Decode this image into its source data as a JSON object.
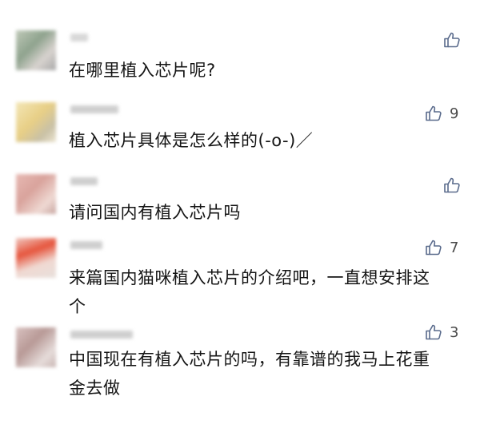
{
  "comments": [
    {
      "text": "在哪里植入芯片呢?",
      "likes": ""
    },
    {
      "text": "植入芯片具体是怎么样的(-o-)／",
      "likes": "9"
    },
    {
      "text": "请问国内有植入芯片吗",
      "likes": ""
    },
    {
      "text": "来篇国内猫咪植入芯片的介绍吧，一直想安排这个",
      "likes": "7"
    },
    {
      "text": "中国现在有植入芯片的吗，有靠谱的我马上花重金去做",
      "likes": "3"
    }
  ],
  "icons": {
    "like": "thumbs-up-icon"
  },
  "colors": {
    "text": "#141414",
    "icon": "#5a6b8c",
    "background": "#ffffff"
  }
}
